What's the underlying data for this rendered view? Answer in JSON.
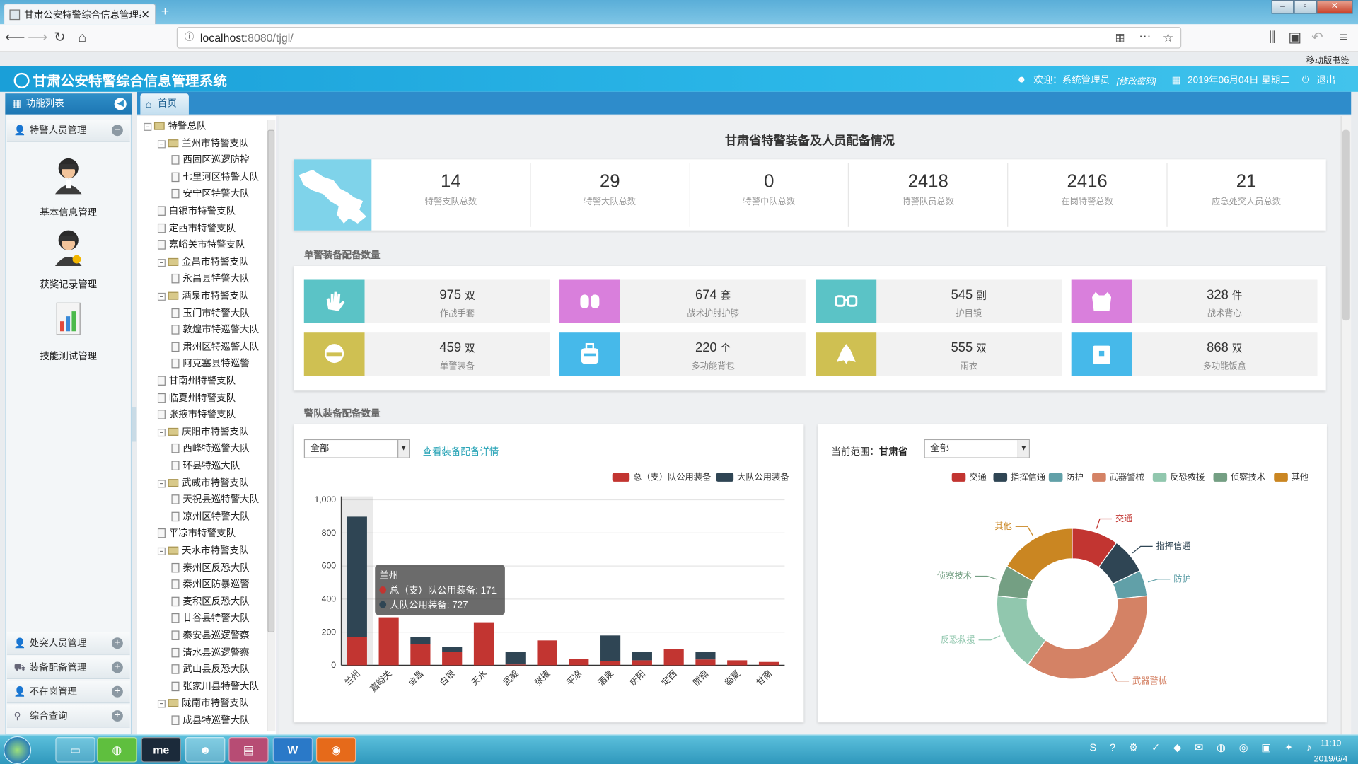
{
  "browser": {
    "tab_title": "甘肃公安特警综合信息管理系统",
    "url_host": "localhost",
    "url_rest": ":8080/tjgl/",
    "bookmark": "移动版书签"
  },
  "app": {
    "title": "甘肃公安特警综合信息管理系统",
    "welcome": "欢迎：系统管理员",
    "change_pwd": "[修改密码]",
    "date": "2019年06月04日 星期二",
    "logout": "退出"
  },
  "menu": {
    "header": "功能列表",
    "section1": "特警人员管理",
    "items": [
      {
        "label": "基本信息管理"
      },
      {
        "label": "获奖记录管理"
      },
      {
        "label": "技能测试管理"
      }
    ],
    "bottom_sections": [
      "处突人员管理",
      "装备配备管理",
      "不在岗管理",
      "综合查询"
    ]
  },
  "tab": {
    "home": "首页"
  },
  "tree": [
    {
      "t": "特警总队",
      "d": 0,
      "f": true
    },
    {
      "t": "兰州市特警支队",
      "d": 1,
      "f": true
    },
    {
      "t": "西固区巡逻防控",
      "d": 2
    },
    {
      "t": "七里河区特警大队",
      "d": 2
    },
    {
      "t": "安宁区特警大队",
      "d": 2
    },
    {
      "t": "白银市特警支队",
      "d": 1
    },
    {
      "t": "定西市特警支队",
      "d": 1
    },
    {
      "t": "嘉峪关市特警支队",
      "d": 1
    },
    {
      "t": "金昌市特警支队",
      "d": 1,
      "f": true
    },
    {
      "t": "永昌县特警大队",
      "d": 2
    },
    {
      "t": "酒泉市特警支队",
      "d": 1,
      "f": true
    },
    {
      "t": "玉门市特警大队",
      "d": 2
    },
    {
      "t": "敦煌市特巡警大队",
      "d": 2
    },
    {
      "t": "肃州区特巡警大队",
      "d": 2
    },
    {
      "t": "阿克塞县特巡警",
      "d": 2
    },
    {
      "t": "甘南州特警支队",
      "d": 1
    },
    {
      "t": "临夏州特警支队",
      "d": 1
    },
    {
      "t": "张掖市特警支队",
      "d": 1
    },
    {
      "t": "庆阳市特警支队",
      "d": 1,
      "f": true
    },
    {
      "t": "西峰特巡警大队",
      "d": 2
    },
    {
      "t": "环县特巡大队",
      "d": 2
    },
    {
      "t": "武威市特警支队",
      "d": 1,
      "f": true
    },
    {
      "t": "天祝县巡特警大队",
      "d": 2
    },
    {
      "t": "凉州区特警大队",
      "d": 2
    },
    {
      "t": "平凉市特警支队",
      "d": 1
    },
    {
      "t": "天水市特警支队",
      "d": 1,
      "f": true
    },
    {
      "t": "秦州区反恐大队",
      "d": 2
    },
    {
      "t": "秦州区防暴巡警",
      "d": 2
    },
    {
      "t": "麦积区反恐大队",
      "d": 2
    },
    {
      "t": "甘谷县特警大队",
      "d": 2
    },
    {
      "t": "秦安县巡逻警察",
      "d": 2
    },
    {
      "t": "清水县巡逻警察",
      "d": 2
    },
    {
      "t": "武山县反恐大队",
      "d": 2
    },
    {
      "t": "张家川县特警大队",
      "d": 2
    },
    {
      "t": "陇南市特警支队",
      "d": 1,
      "f": true
    },
    {
      "t": "成县特巡警大队",
      "d": 2
    }
  ],
  "main": {
    "title": "甘肃省特警装备及人员配备情况",
    "stats": [
      {
        "n": "14",
        "l": "特警支队总数"
      },
      {
        "n": "29",
        "l": "特警大队总数"
      },
      {
        "n": "0",
        "l": "特警中队总数"
      },
      {
        "n": "2418",
        "l": "特警队员总数"
      },
      {
        "n": "2416",
        "l": "在岗特警总数"
      },
      {
        "n": "21",
        "l": "应急处突人员总数"
      }
    ],
    "single_head": "单警装备配备数量",
    "equipment": [
      {
        "v": "975",
        "u": "双",
        "l": "作战手套",
        "c": "#5bc3c6",
        "icon": "glove-icon"
      },
      {
        "v": "674",
        "u": "套",
        "l": "战术护肘护膝",
        "c": "#d97fdc",
        "icon": "kneepad-icon"
      },
      {
        "v": "545",
        "u": "副",
        "l": "护目镜",
        "c": "#5bc3c6",
        "icon": "goggles-icon"
      },
      {
        "v": "328",
        "u": "件",
        "l": "战术背心",
        "c": "#d97fdc",
        "icon": "vest-icon"
      },
      {
        "v": "459",
        "u": "双",
        "l": "单警装备",
        "c": "#cfc052",
        "icon": "helmet-icon"
      },
      {
        "v": "220",
        "u": "个",
        "l": "多功能背包",
        "c": "#46b9ea",
        "icon": "backpack-icon"
      },
      {
        "v": "555",
        "u": "双",
        "l": "雨衣",
        "c": "#cfc052",
        "icon": "raincoat-icon"
      },
      {
        "v": "868",
        "u": "双",
        "l": "多功能饭盒",
        "c": "#46b9ea",
        "icon": "lunchbox-icon"
      }
    ],
    "team_head": "警队装备配备数量",
    "select_all": "全部",
    "detail_link": "查看装备配备详情",
    "scope_label": "当前范围：",
    "scope_value": "甘肃省"
  },
  "chart_data": [
    {
      "type": "bar",
      "stacked": true,
      "categories": [
        "兰州",
        "嘉峪关",
        "金昌",
        "白银",
        "天水",
        "武威",
        "张掖",
        "平凉",
        "酒泉",
        "庆阳",
        "定西",
        "陇南",
        "临夏",
        "甘南"
      ],
      "series": [
        {
          "name": "总（支）队公用装备",
          "color": "#c23531",
          "values": [
            171,
            290,
            130,
            80,
            260,
            5,
            150,
            40,
            25,
            30,
            100,
            35,
            30,
            20
          ]
        },
        {
          "name": "大队公用装备",
          "color": "#2f4554",
          "values": [
            727,
            0,
            40,
            30,
            0,
            75,
            0,
            0,
            155,
            50,
            0,
            45,
            0,
            0
          ]
        }
      ],
      "ylim": [
        0,
        1000
      ],
      "yticks": [
        0,
        200,
        400,
        600,
        800,
        "1,000"
      ],
      "legend": "top-right",
      "tooltip": {
        "category": "兰州",
        "lines": [
          "总（支）队公用装备: 171",
          "大队公用装备: 727"
        ]
      }
    },
    {
      "type": "pie",
      "donut": true,
      "legend": "top",
      "slices": [
        {
          "name": "交通",
          "value": 9,
          "color": "#c23531"
        },
        {
          "name": "指挥信通",
          "value": 7,
          "color": "#2f4554"
        },
        {
          "name": "防护",
          "value": 5,
          "color": "#61a0a8"
        },
        {
          "name": "武器警械",
          "value": 33,
          "color": "#d48265"
        },
        {
          "name": "反恐救援",
          "value": 15,
          "color": "#91c7ae"
        },
        {
          "name": "侦察技术",
          "value": 6,
          "color": "#749f83"
        },
        {
          "name": "其他",
          "value": 15,
          "color": "#ca8622"
        }
      ]
    }
  ],
  "taskbar": {
    "clock_time": "11:10",
    "clock_date": "2019/6/4"
  }
}
